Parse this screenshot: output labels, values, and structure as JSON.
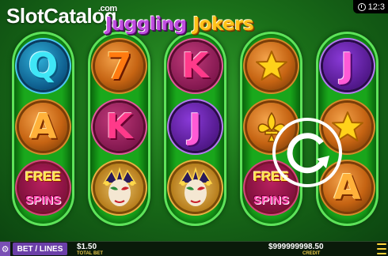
{
  "watermark": {
    "brand": "SlotCatalog",
    "suffix": ".com"
  },
  "game_title": {
    "word1": "Juggling",
    "word2": "Jokers"
  },
  "clock": {
    "time": "12:3"
  },
  "reels": [
    [
      "Q",
      "A",
      "FREE SPINS"
    ],
    [
      "7",
      "K",
      "joker-mask"
    ],
    [
      "K",
      "J",
      "joker-mask"
    ],
    [
      "star",
      "fleur-de-lis",
      "FREE SPINS"
    ],
    [
      "J",
      "star",
      "A"
    ]
  ],
  "symbols": {
    "free_top": "FREE",
    "free_bottom": "SPINS"
  },
  "bottom_bar": {
    "bet_button": "BET / LINES",
    "total_bet_value": "$1.50",
    "total_bet_label": "TOTAL BET",
    "credit_value": "$999999998.50",
    "credit_label": "CREDIT"
  },
  "icons": {
    "settings": "gear-icon",
    "menu": "hamburger-icon",
    "spin": "spin-arrow-icon",
    "clock": "clock-icon"
  },
  "colors": {
    "accent": "#6b3fa8",
    "label": "#e8c84a",
    "reel_green": "#1aa81c"
  }
}
